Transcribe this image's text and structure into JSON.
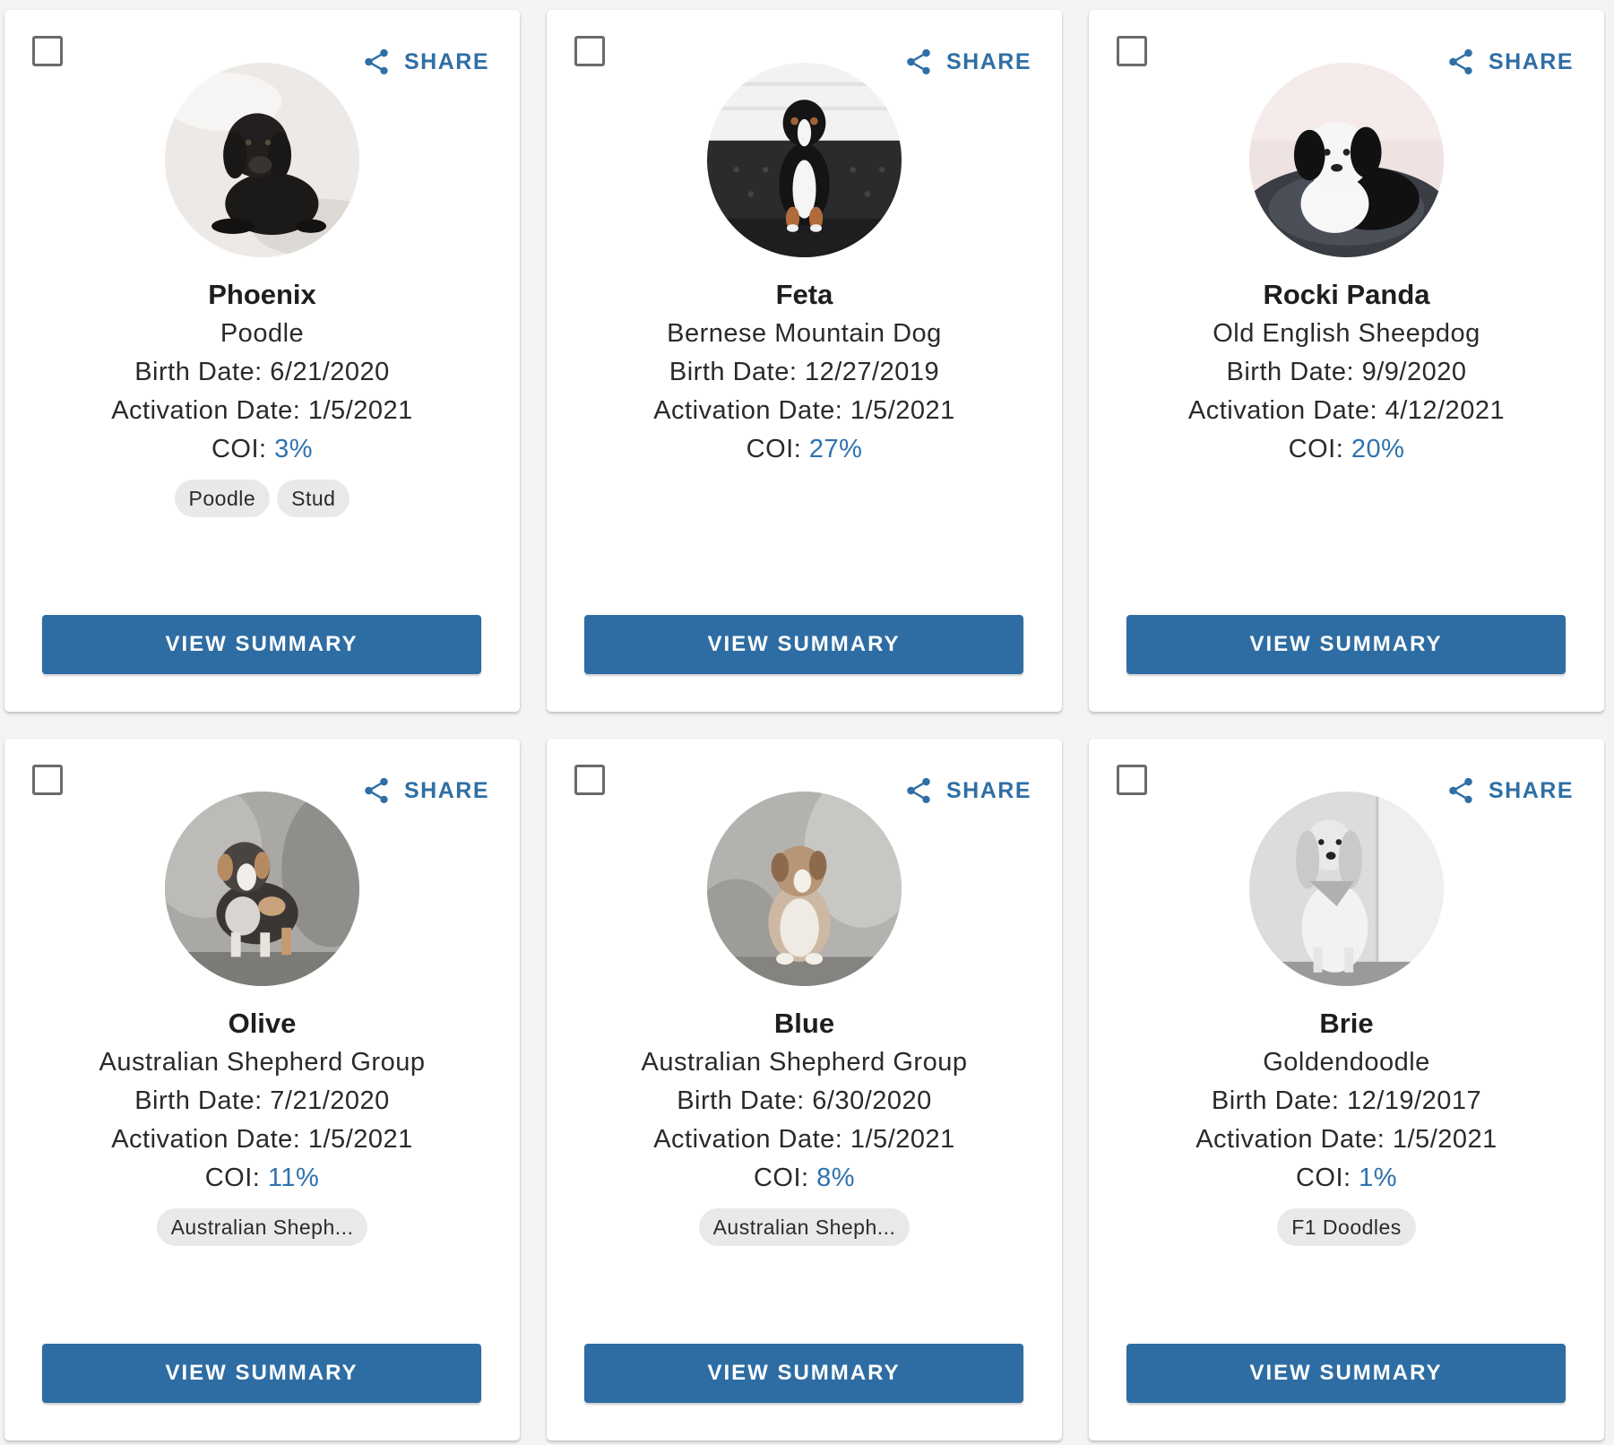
{
  "colors": {
    "accent": "#2e6da3",
    "coi_value": "#2f72ad",
    "chip_bg": "#e9e9e9"
  },
  "share_label": "SHARE",
  "view_summary_label": "VIEW SUMMARY",
  "labels": {
    "birth": "Birth Date: ",
    "activation": "Activation Date: ",
    "coi": "COI: "
  },
  "dogs": [
    {
      "name": "Phoenix",
      "breed": "Poodle",
      "birth_date": "6/21/2020",
      "activation_date": "1/5/2021",
      "coi": "3%",
      "tags": [
        "Poodle",
        "Stud"
      ],
      "photo": "black poodle puppy on white fur"
    },
    {
      "name": "Feta",
      "breed": "Bernese Mountain Dog",
      "birth_date": "12/27/2019",
      "activation_date": "1/5/2021",
      "coi": "27%",
      "tags": [],
      "photo": "bernese puppy on dark bench"
    },
    {
      "name": "Rocki Panda",
      "breed": "Old English Sheepdog",
      "birth_date": "9/9/2020",
      "activation_date": "4/12/2021",
      "coi": "20%",
      "tags": [],
      "photo": "black and white sheepdog puppy on blanket"
    },
    {
      "name": "Olive",
      "breed": "Australian Shepherd Group",
      "birth_date": "7/21/2020",
      "activation_date": "1/5/2021",
      "coi": "11%",
      "tags": [
        "Australian Sheph..."
      ],
      "photo": "merle australian shepherd puppy on rock"
    },
    {
      "name": "Blue",
      "breed": "Australian Shepherd Group",
      "birth_date": "6/30/2020",
      "activation_date": "1/5/2021",
      "coi": "8%",
      "tags": [
        "Australian Sheph..."
      ],
      "photo": "australian shepherd puppy sitting on rock"
    },
    {
      "name": "Brie",
      "breed": "Goldendoodle",
      "birth_date": "12/19/2017",
      "activation_date": "1/5/2021",
      "coi": "1%",
      "tags": [
        "F1 Doodles"
      ],
      "photo": "black and white photo of goldendoodle with bandana"
    }
  ]
}
